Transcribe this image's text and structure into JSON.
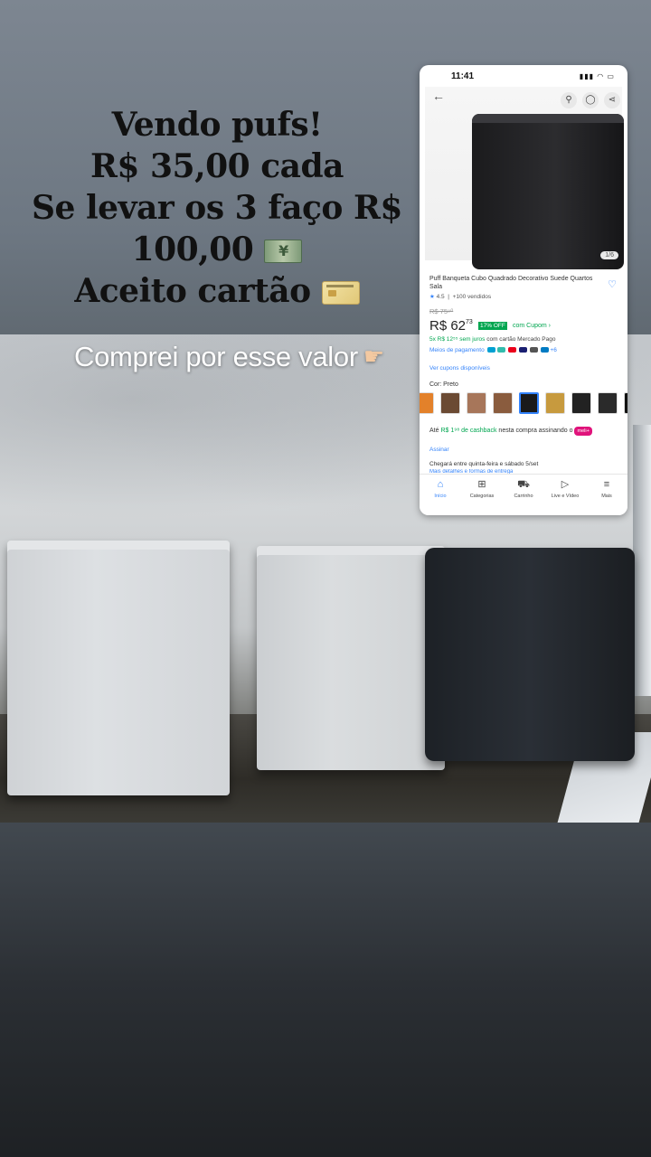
{
  "headline": {
    "line1": "Vendo pufs!",
    "line2": "R$ 35,00 cada",
    "line3": "Se levar os 3 faço R$",
    "line4": "100,00",
    "line5": "Aceito cartão"
  },
  "caption": "Comprei por esse valor",
  "icons": {
    "money": "money-bill-emoji",
    "card": "credit-card-emoji",
    "hand": "pointing-right-hand-emoji"
  },
  "phone": {
    "time": "11:41",
    "image_counter": "1/6",
    "title": "Puff Banqueta Cubo Quadrado Decorativo Suede Quartos Sala",
    "rating": "4.5",
    "sold": "+100 vendidos",
    "old_price": "R$ 75⁹⁰",
    "price_main": "R$ 62",
    "price_cents": "73",
    "discount": "17% OFF",
    "coupon": "com Cupom",
    "installments_green": "5x R$ 12⁵⁵ sem juros",
    "installments_rest": "com cartão Mercado Pago",
    "payment_methods": "Meios de pagamento",
    "payment_more": "+6",
    "coupons_link": "Ver cupons disponíveis",
    "color_label": "Cor: Preto",
    "cashback_prefix": "Até",
    "cashback_value": "R$ 1⁹⁸ de cashback",
    "cashback_suffix": "nesta compra assinando o",
    "meli_badge": "meli+",
    "subscribe": "Assinar",
    "delivery": "Chegará entre quinta-feira e sábado 5/set",
    "delivery_more": "Mais detalhes e formas de entrega",
    "tabs": [
      "Início",
      "Categorias",
      "Carrinho",
      "Live e Vídeo",
      "Mais"
    ],
    "swatch_colors": [
      "#e3812a",
      "#6b4a33",
      "#a7765a",
      "#8a5c3e",
      "#1a1a1a",
      "#c79a3e",
      "#222222",
      "#2a2a2a",
      "#111111"
    ],
    "accent": "#3483fa",
    "green": "#00a650"
  }
}
